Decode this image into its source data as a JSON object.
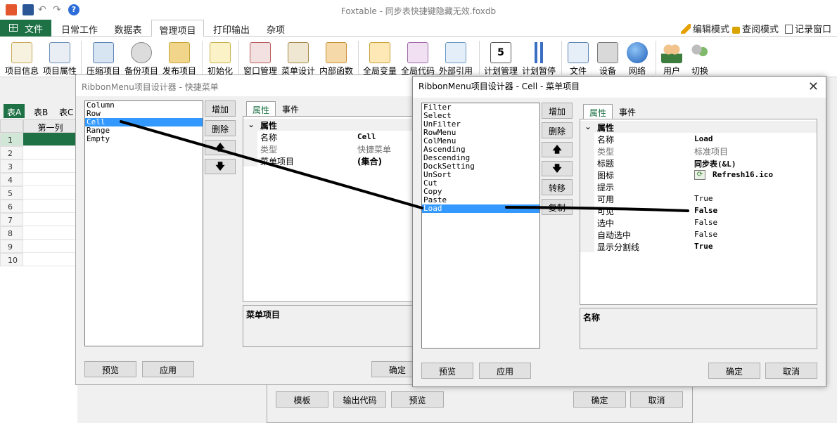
{
  "app": {
    "title": "Foxtable - 同步表快捷键隐藏无效.foxdb"
  },
  "colors": {
    "brand": "#1e7145",
    "selection": "#3399ff"
  },
  "ribbon_tabs": {
    "file": "文件",
    "daily": "日常工作",
    "tables": "数据表",
    "manage": "管理项目",
    "print": "打印输出",
    "misc": "杂项"
  },
  "ribbon_right": {
    "edit_mode": "编辑模式",
    "view_mode": "查阅模式",
    "log_window": "记录窗口"
  },
  "ribbon_buttons": [
    "项目信息",
    "项目属性",
    "压缩项目",
    "备份项目",
    "发布项目",
    "初始化",
    "窗口管理",
    "菜单设计",
    "内部函数",
    "全局变量",
    "全局代码",
    "外部引用",
    "计划管理",
    "计划暂停",
    "文件",
    "设备",
    "网络",
    "用户",
    "切换"
  ],
  "sheet": {
    "tabs": [
      "表A",
      "表B",
      "表C"
    ],
    "column_header": "第一列",
    "rows": [
      "1",
      "2",
      "3",
      "4",
      "5",
      "6",
      "7",
      "8",
      "9",
      "10"
    ]
  },
  "dialog_quick": {
    "title": "RibbonMenu项目设计器 - 快捷菜单",
    "items": [
      "Column",
      "Row",
      "Cell",
      "Range",
      "Empty"
    ],
    "selected_index": 2,
    "btn_add": "增加",
    "btn_delete": "删除",
    "btn_up": "🡅",
    "btn_down": "🡇",
    "btn_preview": "预览",
    "btn_apply": "应用",
    "btn_ok": "确定",
    "tab_props": "属性",
    "tab_events": "事件",
    "cat": "属性",
    "props": [
      {
        "name": "名称",
        "value": "Cell",
        "bold": true
      },
      {
        "name": "类型",
        "value": "快捷菜单",
        "grey": true
      },
      {
        "name": "菜单项目",
        "value": "(集合)",
        "bold": true
      }
    ],
    "desc": "菜单项目"
  },
  "dialog_back": {
    "btn_template": "模板",
    "btn_export": "输出代码",
    "btn_preview": "预览",
    "btn_ok": "确定",
    "btn_cancel": "取消"
  },
  "dialog_cell": {
    "title": "RibbonMenu项目设计器 - Cell - 菜单项目",
    "items": [
      "Filter",
      "Select",
      "UnFilter",
      "RowMenu",
      "ColMenu",
      "Ascending",
      "Descending",
      "DockSetting",
      "UnSort",
      "Cut",
      "Copy",
      "Paste",
      "Load"
    ],
    "selected_index": 12,
    "btn_add": "增加",
    "btn_delete": "删除",
    "btn_up": "🡅",
    "btn_down": "🡇",
    "btn_move": "转移",
    "btn_copy": "复制",
    "btn_preview": "预览",
    "btn_apply": "应用",
    "btn_ok": "确定",
    "btn_cancel": "取消",
    "tab_props": "属性",
    "tab_events": "事件",
    "cat": "属性",
    "props": [
      {
        "name": "名称",
        "value": "Load",
        "bold": true
      },
      {
        "name": "类型",
        "value": "标准项目",
        "grey": true
      },
      {
        "name": "标题",
        "value": "同步表(&L)",
        "bold": true
      },
      {
        "name": "图标",
        "value": "Refresh16.ico",
        "bold": true,
        "icon": true
      },
      {
        "name": "提示",
        "value": ""
      },
      {
        "name": "可用",
        "value": "True"
      },
      {
        "name": "可见",
        "value": "False",
        "bold": true
      },
      {
        "name": "选中",
        "value": "False"
      },
      {
        "name": "自动选中",
        "value": "False"
      },
      {
        "name": "显示分割线",
        "value": "True",
        "bold": true
      }
    ],
    "desc": "名称"
  }
}
